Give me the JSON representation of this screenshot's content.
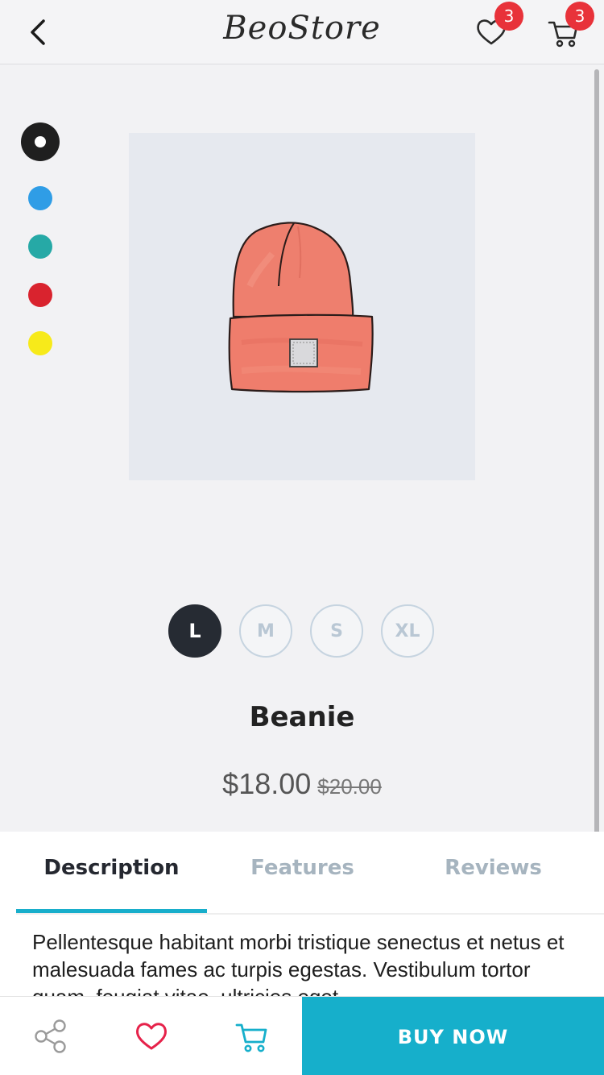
{
  "header": {
    "logo_text": "BeoStore",
    "wishlist_count": "3",
    "cart_count": "3"
  },
  "product": {
    "colors": [
      {
        "name": "black",
        "hex": "#1f1f1f",
        "selected": true
      },
      {
        "name": "blue",
        "hex": "#2f9de6",
        "selected": false
      },
      {
        "name": "teal",
        "hex": "#26a9a6",
        "selected": false
      },
      {
        "name": "red",
        "hex": "#d9232e",
        "selected": false
      },
      {
        "name": "yellow",
        "hex": "#f7ea1a",
        "selected": false
      }
    ],
    "image_icon": "beanie-illustration",
    "sizes": [
      {
        "label": "L",
        "selected": true
      },
      {
        "label": "M",
        "selected": false
      },
      {
        "label": "S",
        "selected": false
      },
      {
        "label": "XL",
        "selected": false
      }
    ],
    "name": "Beanie",
    "price": "$18.00",
    "old_price": "$20.00"
  },
  "tabs": [
    {
      "label": "Description",
      "active": true
    },
    {
      "label": "Features",
      "active": false
    },
    {
      "label": "Reviews",
      "active": false
    }
  ],
  "description": "Pellentesque habitant morbi tristique senectus et netus et malesuada fames ac turpis egestas. Vestibulum tortor quam, feugiat vitae, ultricies eget",
  "bottom_bar": {
    "buy_label": "BUY NOW"
  },
  "colors": {
    "accent": "#16afcb",
    "badge": "#e8323a",
    "heart": "#e6224a",
    "dark": "#262b33"
  }
}
